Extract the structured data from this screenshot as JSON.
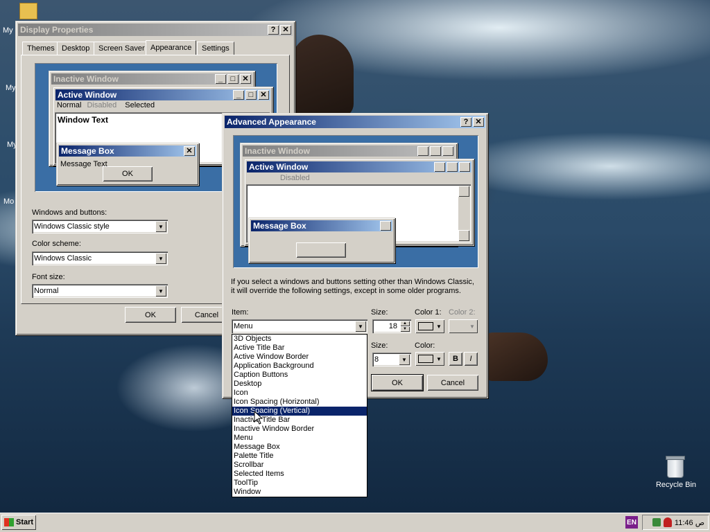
{
  "desktop": {
    "icons": [
      "My",
      "My",
      "My",
      "Mo"
    ],
    "recycle_bin": "Recycle Bin"
  },
  "display_properties": {
    "title": "Display Properties",
    "tabs": [
      "Themes",
      "Desktop",
      "Screen Saver",
      "Appearance",
      "Settings"
    ],
    "selected_tab": "Appearance",
    "preview": {
      "inactive_title": "Inactive Window",
      "active_title": "Active Window",
      "menu_normal": "Normal",
      "menu_disabled": "Disabled",
      "menu_selected": "Selected",
      "window_text": "Window Text",
      "msgbox_title": "Message Box",
      "msgbox_text": "Message Text",
      "msgbox_ok": "OK"
    },
    "windows_buttons_label": "Windows and buttons:",
    "windows_buttons_value": "Windows Classic style",
    "color_scheme_label": "Color scheme:",
    "color_scheme_value": "Windows Classic",
    "font_size_label": "Font size:",
    "font_size_value": "Normal",
    "ok": "OK",
    "cancel": "Cancel"
  },
  "advanced": {
    "title": "Advanced Appearance",
    "preview": {
      "inactive_title": "Inactive Window",
      "active_title": "Active Window",
      "menu_disabled": "Disabled",
      "msgbox_title": "Message Box"
    },
    "info_line1": "If you select a windows and buttons setting other than Windows Classic,",
    "info_line2": "it will override the following settings, except in some older programs.",
    "item_label": "Item:",
    "item_value": "Menu",
    "size_label": "Size:",
    "size_value": "18",
    "color1_label": "Color 1:",
    "color2_label": "Color 2:",
    "font_size_label": "Size:",
    "font_size_value": "8",
    "font_color_label": "Color:",
    "bold": "B",
    "italic": "I",
    "ok": "OK",
    "cancel": "Cancel",
    "item_options": [
      "3D Objects",
      "Active Title Bar",
      "Active Window Border",
      "Application Background",
      "Caption Buttons",
      "Desktop",
      "Icon",
      "Icon Spacing (Horizontal)",
      "Icon Spacing (Vertical)",
      "Inactive Title Bar",
      "Inactive Window Border",
      "Menu",
      "Message Box",
      "Palette Title",
      "Scrollbar",
      "Selected Items",
      "ToolTip",
      "Window"
    ],
    "highlighted_option": "Icon Spacing (Vertical)"
  },
  "taskbar": {
    "start": "Start",
    "lang": "EN",
    "time": "11:46 ص"
  }
}
